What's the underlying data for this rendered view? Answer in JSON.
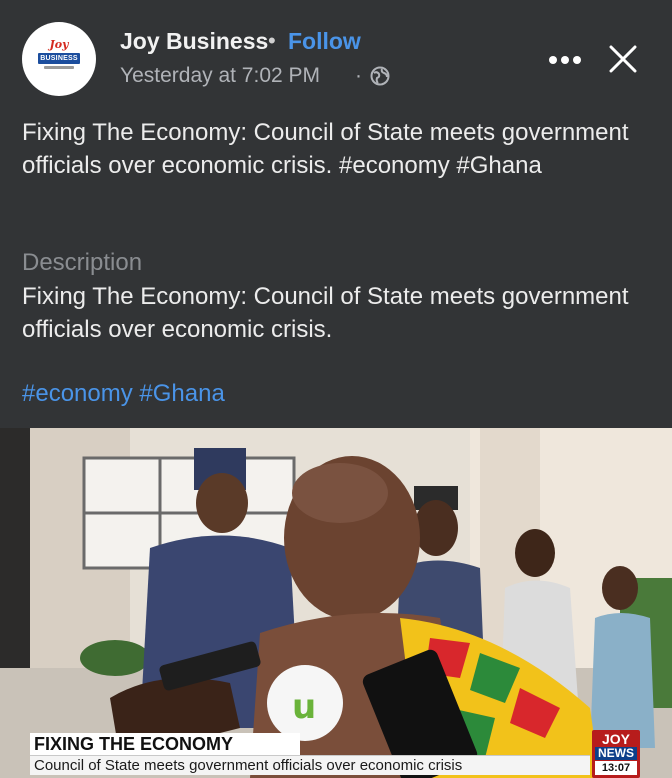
{
  "post": {
    "page_name": "Joy Business",
    "separator": "•",
    "follow_label": "Follow",
    "timestamp": "Yesterday at 7:02 PM",
    "timestamp_separator": "·",
    "audience_icon": "globe-icon",
    "more_icon": "more-options-icon",
    "close_icon": "close-icon",
    "avatar": {
      "logo_text": "Joy",
      "logo_subtext": "BUSINESS"
    },
    "caption": "Fixing The Economy: Council of State meets government officials over economic crisis. #economy #Ghana",
    "description_label": "Description",
    "description_text": "Fixing The Economy: Council of State meets government officials over economic crisis.",
    "hashtags": "#economy #Ghana"
  },
  "video": {
    "lower_third_title": "FIXING THE ECONOMY",
    "lower_third_subtitle": "Council of State meets government officials over economic crisis",
    "channel_logo_line1": "JOY",
    "channel_logo_line2": "NEWS",
    "channel_time": "13:07"
  },
  "colors": {
    "background": "#323436",
    "link_blue": "#4a94e8",
    "muted_text": "#8a8d91"
  }
}
